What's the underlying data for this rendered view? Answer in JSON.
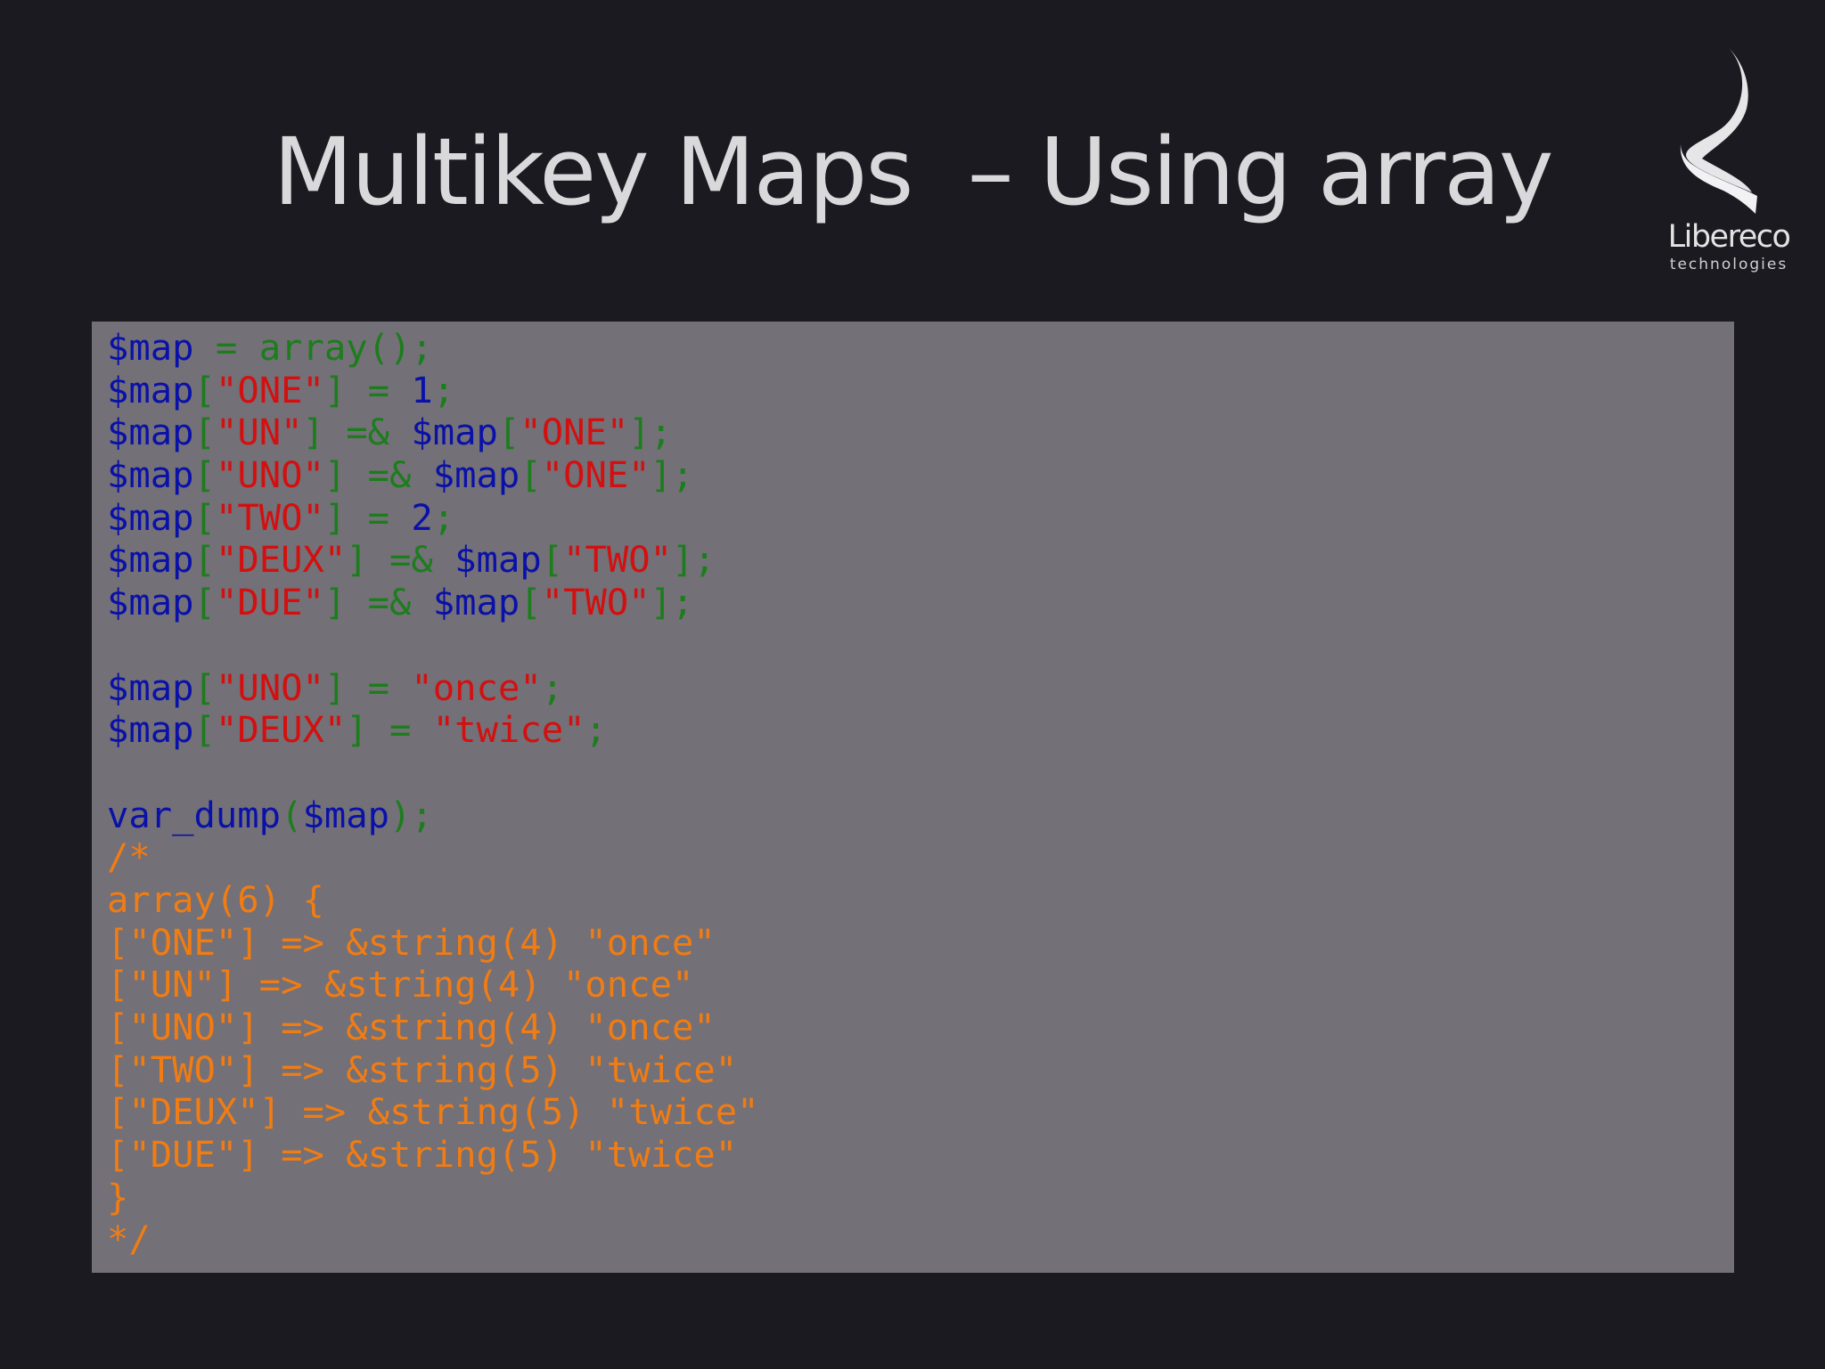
{
  "slide": {
    "title": "Multikey Maps  – Using array"
  },
  "logo": {
    "name": "Libereco",
    "subtitle": "technologies"
  },
  "colors": {
    "background": "#1b1a20",
    "panel": "#737077",
    "variable": "#0a11a8",
    "operator": "#1c7d1c",
    "string": "#d40f0f",
    "comment": "#f07c14"
  },
  "code_lines": [
    [
      {
        "t": "$map",
        "c": "var"
      },
      {
        "t": " = array();",
        "c": "op"
      }
    ],
    [
      {
        "t": "$map",
        "c": "var"
      },
      {
        "t": "[",
        "c": "op"
      },
      {
        "t": "\"ONE\"",
        "c": "str"
      },
      {
        "t": "] = ",
        "c": "op"
      },
      {
        "t": "1",
        "c": "num"
      },
      {
        "t": ";",
        "c": "op"
      }
    ],
    [
      {
        "t": "$map",
        "c": "var"
      },
      {
        "t": "[",
        "c": "op"
      },
      {
        "t": "\"UN\"",
        "c": "str"
      },
      {
        "t": "] =& ",
        "c": "op"
      },
      {
        "t": "$map",
        "c": "var"
      },
      {
        "t": "[",
        "c": "op"
      },
      {
        "t": "\"ONE\"",
        "c": "str"
      },
      {
        "t": "];",
        "c": "op"
      }
    ],
    [
      {
        "t": "$map",
        "c": "var"
      },
      {
        "t": "[",
        "c": "op"
      },
      {
        "t": "\"UNO\"",
        "c": "str"
      },
      {
        "t": "] =& ",
        "c": "op"
      },
      {
        "t": "$map",
        "c": "var"
      },
      {
        "t": "[",
        "c": "op"
      },
      {
        "t": "\"ONE\"",
        "c": "str"
      },
      {
        "t": "];",
        "c": "op"
      }
    ],
    [
      {
        "t": "$map",
        "c": "var"
      },
      {
        "t": "[",
        "c": "op"
      },
      {
        "t": "\"TWO\"",
        "c": "str"
      },
      {
        "t": "] = ",
        "c": "op"
      },
      {
        "t": "2",
        "c": "num"
      },
      {
        "t": ";",
        "c": "op"
      }
    ],
    [
      {
        "t": "$map",
        "c": "var"
      },
      {
        "t": "[",
        "c": "op"
      },
      {
        "t": "\"DEUX\"",
        "c": "str"
      },
      {
        "t": "] =& ",
        "c": "op"
      },
      {
        "t": "$map",
        "c": "var"
      },
      {
        "t": "[",
        "c": "op"
      },
      {
        "t": "\"TWO\"",
        "c": "str"
      },
      {
        "t": "];",
        "c": "op"
      }
    ],
    [
      {
        "t": "$map",
        "c": "var"
      },
      {
        "t": "[",
        "c": "op"
      },
      {
        "t": "\"DUE\"",
        "c": "str"
      },
      {
        "t": "] =& ",
        "c": "op"
      },
      {
        "t": "$map",
        "c": "var"
      },
      {
        "t": "[",
        "c": "op"
      },
      {
        "t": "\"TWO\"",
        "c": "str"
      },
      {
        "t": "];",
        "c": "op"
      }
    ],
    [],
    [
      {
        "t": "$map",
        "c": "var"
      },
      {
        "t": "[",
        "c": "op"
      },
      {
        "t": "\"UNO\"",
        "c": "str"
      },
      {
        "t": "] = ",
        "c": "op"
      },
      {
        "t": "\"once\"",
        "c": "str"
      },
      {
        "t": ";",
        "c": "op"
      }
    ],
    [
      {
        "t": "$map",
        "c": "var"
      },
      {
        "t": "[",
        "c": "op"
      },
      {
        "t": "\"DEUX\"",
        "c": "str"
      },
      {
        "t": "] = ",
        "c": "op"
      },
      {
        "t": "\"twice\"",
        "c": "str"
      },
      {
        "t": ";",
        "c": "op"
      }
    ],
    [],
    [
      {
        "t": "var_dump",
        "c": "fn"
      },
      {
        "t": "(",
        "c": "op"
      },
      {
        "t": "$map",
        "c": "var"
      },
      {
        "t": ");",
        "c": "op"
      }
    ],
    [
      {
        "t": "/*",
        "c": "comment"
      }
    ],
    [
      {
        "t": "array(6) {",
        "c": "comment"
      }
    ],
    [
      {
        "t": "[\"ONE\"] => &string(4) \"once\"",
        "c": "comment"
      }
    ],
    [
      {
        "t": "[\"UN\"] => &string(4) \"once\"",
        "c": "comment"
      }
    ],
    [
      {
        "t": "[\"UNO\"] => &string(4) \"once\"",
        "c": "comment"
      }
    ],
    [
      {
        "t": "[\"TWO\"] => &string(5) \"twice\"",
        "c": "comment"
      }
    ],
    [
      {
        "t": "[\"DEUX\"] => &string(5) \"twice\"",
        "c": "comment"
      }
    ],
    [
      {
        "t": "[\"DUE\"] => &string(5) \"twice\"",
        "c": "comment"
      }
    ],
    [
      {
        "t": "}",
        "c": "comment"
      }
    ],
    [
      {
        "t": "*/",
        "c": "comment"
      }
    ]
  ]
}
